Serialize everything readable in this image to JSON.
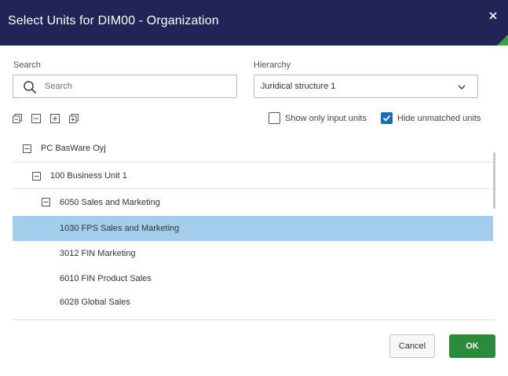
{
  "dialog": {
    "title": "Select Units for DIM00 - Organization",
    "close_icon": "close-icon",
    "accent_color": "#202456",
    "corner_color": "#3aa14a"
  },
  "search": {
    "label": "Search",
    "placeholder": "Search",
    "value": ""
  },
  "hierarchy": {
    "label": "Hierarchy",
    "selected": "Juridical structure 1"
  },
  "toolbar": {
    "icons": [
      "collapse-all-icon",
      "collapse-icon",
      "expand-icon",
      "expand-all-icon"
    ]
  },
  "options": {
    "show_only_input_units": {
      "label": "Show only input units",
      "checked": false
    },
    "hide_unmatched_units": {
      "label": "Hide unmatched units",
      "checked": true
    }
  },
  "tree": {
    "selected_color": "#a4cdec",
    "nodes": [
      {
        "label": "PC BasWare Oyj",
        "level": 0,
        "expanded": true,
        "selected": false
      },
      {
        "label": "100 Business Unit 1",
        "level": 1,
        "expanded": true,
        "selected": false
      },
      {
        "label": "6050 Sales and Marketing",
        "level": 2,
        "expanded": true,
        "selected": false
      },
      {
        "label": "1030 FPS Sales and Marketing",
        "level": 3,
        "expanded": false,
        "selected": true
      },
      {
        "label": "3012 FIN Marketing",
        "level": 3,
        "expanded": false,
        "selected": false
      },
      {
        "label": "6010 FIN Product Sales",
        "level": 3,
        "expanded": false,
        "selected": false
      },
      {
        "label": "6028 Global Sales",
        "level": 3,
        "expanded": false,
        "selected": false
      }
    ]
  },
  "buttons": {
    "cancel": "Cancel",
    "ok": "OK",
    "ok_color": "#2c8a3d"
  }
}
